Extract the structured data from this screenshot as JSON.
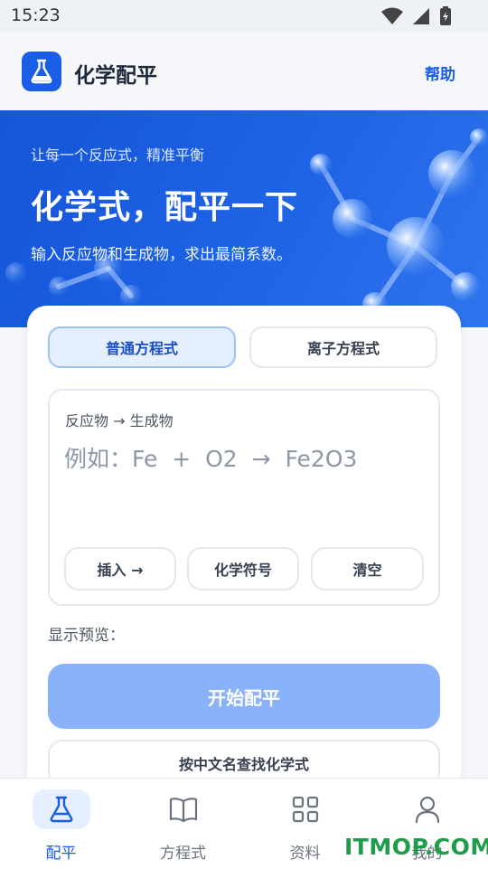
{
  "status_bar": {
    "time": "15:23",
    "icons": [
      "wifi-icon",
      "signal-icon",
      "battery-icon"
    ]
  },
  "header": {
    "app_icon": "flask-icon",
    "title": "化学配平",
    "help_label": "帮助"
  },
  "hero": {
    "eyebrow": "让每一个反应式，精准平衡",
    "title": "化学式，配平一下",
    "subtitle": "输入反应物和生成物，求出最简系数。"
  },
  "tabs": [
    {
      "label": "普通方程式",
      "active": true
    },
    {
      "label": "离子方程式",
      "active": false
    }
  ],
  "equation_input": {
    "label": "反应物 → 生成物",
    "value": "",
    "placeholder": "例如：Fe  +  O2  →  Fe2O3"
  },
  "tool_buttons": [
    {
      "label": "插入 →"
    },
    {
      "label": "化学符号"
    },
    {
      "label": "清空"
    }
  ],
  "preview_label": "显示预览：",
  "balance_button": {
    "label": "开始配平"
  },
  "lookup_button": {
    "label": "按中文名查找化学式"
  },
  "nav": [
    {
      "label": "配平",
      "icon": "flask-icon",
      "active": true
    },
    {
      "label": "方程式",
      "icon": "book-icon",
      "active": false
    },
    {
      "label": "资料",
      "icon": "grid-icon",
      "active": false
    },
    {
      "label": "我的",
      "icon": "user-icon",
      "active": false
    }
  ],
  "watermark": "ITMOP.COM",
  "colors": {
    "primary": "#1a5de6",
    "hero": "#1f63e6",
    "button_disabled": "#8ab2fb",
    "watermark": "#1f9d4b"
  }
}
